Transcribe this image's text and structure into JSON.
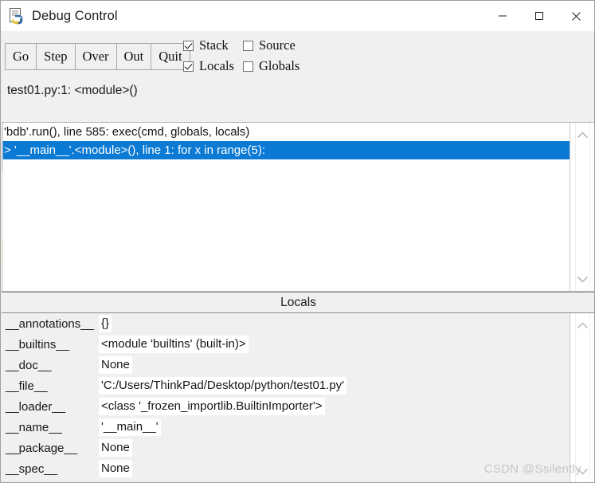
{
  "window": {
    "title": "Debug Control",
    "icon": "python-debug-icon",
    "controls": {
      "minimize": "minimize-icon",
      "maximize": "maximize-icon",
      "close": "close-icon"
    }
  },
  "toolbar": {
    "buttons": [
      {
        "label": "Go"
      },
      {
        "label": "Step"
      },
      {
        "label": "Over"
      },
      {
        "label": "Out"
      },
      {
        "label": "Quit"
      }
    ],
    "checkboxes": [
      {
        "label": "Stack",
        "checked": true
      },
      {
        "label": "Source",
        "checked": false
      },
      {
        "label": "Locals",
        "checked": true
      },
      {
        "label": "Globals",
        "checked": false
      }
    ]
  },
  "status": {
    "line": "test01.py:1: <module>()"
  },
  "stack": {
    "rows": [
      {
        "text": "'bdb'.run(), line 585: exec(cmd, globals, locals)",
        "selected": false
      },
      {
        "text": "> '__main__'.<module>(), line 1: for x in range(5):",
        "selected": true
      }
    ],
    "selection_color": "#0a7ad4"
  },
  "locals": {
    "header": "Locals",
    "rows": [
      {
        "name": "__annotations__",
        "value": "{}"
      },
      {
        "name": "__builtins__",
        "value": "<module 'builtins' (built-in)>"
      },
      {
        "name": "__doc__",
        "value": "None"
      },
      {
        "name": "__file__",
        "value": "'C:/Users/ThinkPad/Desktop/python/test01.py'"
      },
      {
        "name": "__loader__",
        "value": "<class '_frozen_importlib.BuiltinImporter'>"
      },
      {
        "name": "__name__",
        "value": "'__main__'"
      },
      {
        "name": "__package__",
        "value": "None"
      },
      {
        "name": "__spec__",
        "value": "None"
      }
    ]
  },
  "scrollbars": {
    "up_arrow": "chevron-up-icon",
    "down_arrow": "chevron-down-icon"
  },
  "watermark": "CSDN @Ssilently"
}
